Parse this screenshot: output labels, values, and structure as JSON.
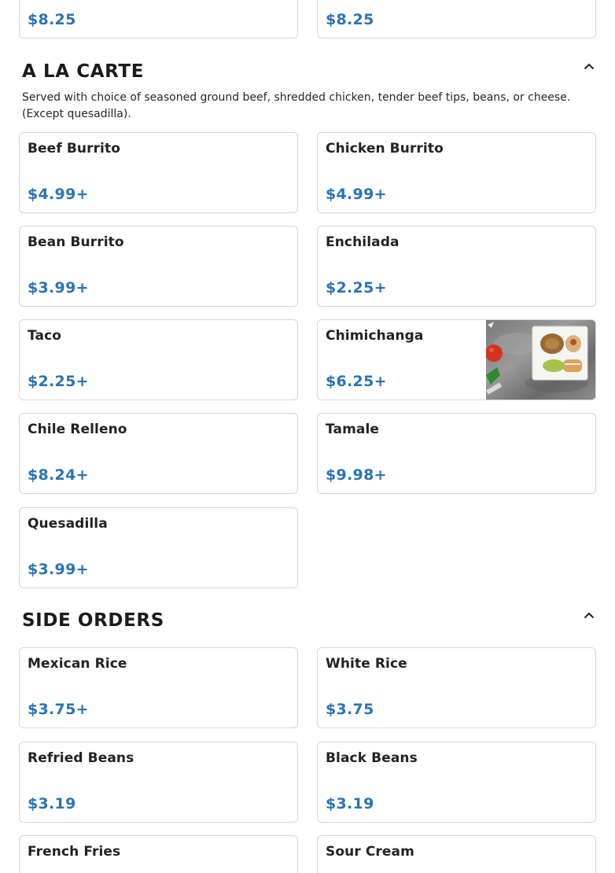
{
  "top_partial": {
    "left_price": "$8.25",
    "right_price": "$8.25"
  },
  "a_la_carte": {
    "title": "A LA CARTE",
    "description": "Served with choice of seasoned ground beef, shredded chicken, tender beef tips, beans, or cheese. (Except quesadilla).",
    "collapse_icon": "chevron-up-icon",
    "items": [
      {
        "name": "Beef Burrito",
        "price": "$4.99+"
      },
      {
        "name": "Chicken Burrito",
        "price": "$4.99+"
      },
      {
        "name": "Bean Burrito",
        "price": "$3.99+"
      },
      {
        "name": "Enchilada",
        "price": "$2.25+"
      },
      {
        "name": "Taco",
        "price": "$2.25+"
      },
      {
        "name": "Chimichanga",
        "price": "$6.25+",
        "image": "chimichanga-photo"
      },
      {
        "name": "Chile Relleno",
        "price": "$8.24+"
      },
      {
        "name": "Tamale",
        "price": "$9.98+"
      },
      {
        "name": "Quesadilla",
        "price": "$3.99+"
      }
    ]
  },
  "side_orders": {
    "title": "SIDE ORDERS",
    "collapse_icon": "chevron-up-icon",
    "items": [
      {
        "name": "Mexican Rice",
        "price": "$3.75+"
      },
      {
        "name": "White Rice",
        "price": "$3.75"
      },
      {
        "name": "Refried Beans",
        "price": "$3.19"
      },
      {
        "name": "Black Beans",
        "price": "$3.19"
      },
      {
        "name": "French Fries",
        "price": ""
      },
      {
        "name": "Sour Cream",
        "price": ""
      }
    ]
  },
  "colors": {
    "price": "#2b73b5",
    "border": "#d6d6d6",
    "text": "#222222"
  }
}
